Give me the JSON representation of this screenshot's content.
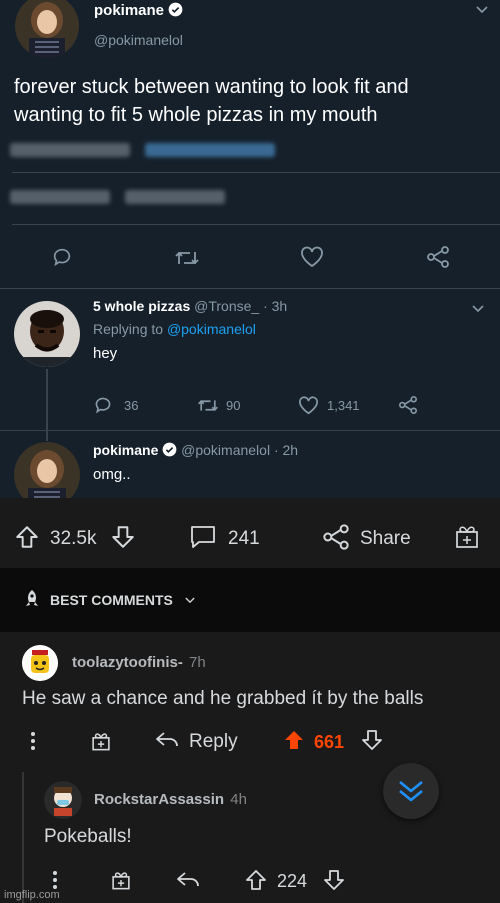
{
  "tweet": {
    "author": "pokimane",
    "handle": "@pokimanelol",
    "text_line1": "forever stuck between wanting to look fit and",
    "text_line2": "wanting to fit 5 whole pizzas in my mouth"
  },
  "reply1": {
    "name": "5 whole pizzas",
    "handle": "@Tronse_",
    "time": "· 3h",
    "replying_prefix": "Replying to",
    "replying_handle": "@pokimanelol",
    "text": "hey",
    "reply_count": "36",
    "retweet_count": "90",
    "like_count": "1,341"
  },
  "reply2": {
    "name": "pokimane",
    "handle": "@pokimanelol",
    "time": "· 2h",
    "text": "omg.."
  },
  "post_bar": {
    "score": "32.5k",
    "comments": "241",
    "share_label": "Share"
  },
  "sort_label": "BEST COMMENTS",
  "comment1": {
    "author": "toolazytoofinis-",
    "time": "7h",
    "text": "He saw a chance and he grabbed ít by the balls",
    "reply_label": "Reply",
    "score": "661"
  },
  "comment2": {
    "author": "RockstarAssassin",
    "time": "4h",
    "text": "Pokeballs!",
    "score": "224"
  },
  "watermark": "imgflip.com",
  "colors": {
    "twitter_bg": "#15202b",
    "twitter_blue": "#1da1f2",
    "reddit_bg": "#0b0b0b",
    "upvote_orange": "#ff4500",
    "jump_button_blue": "#1e90ff"
  }
}
